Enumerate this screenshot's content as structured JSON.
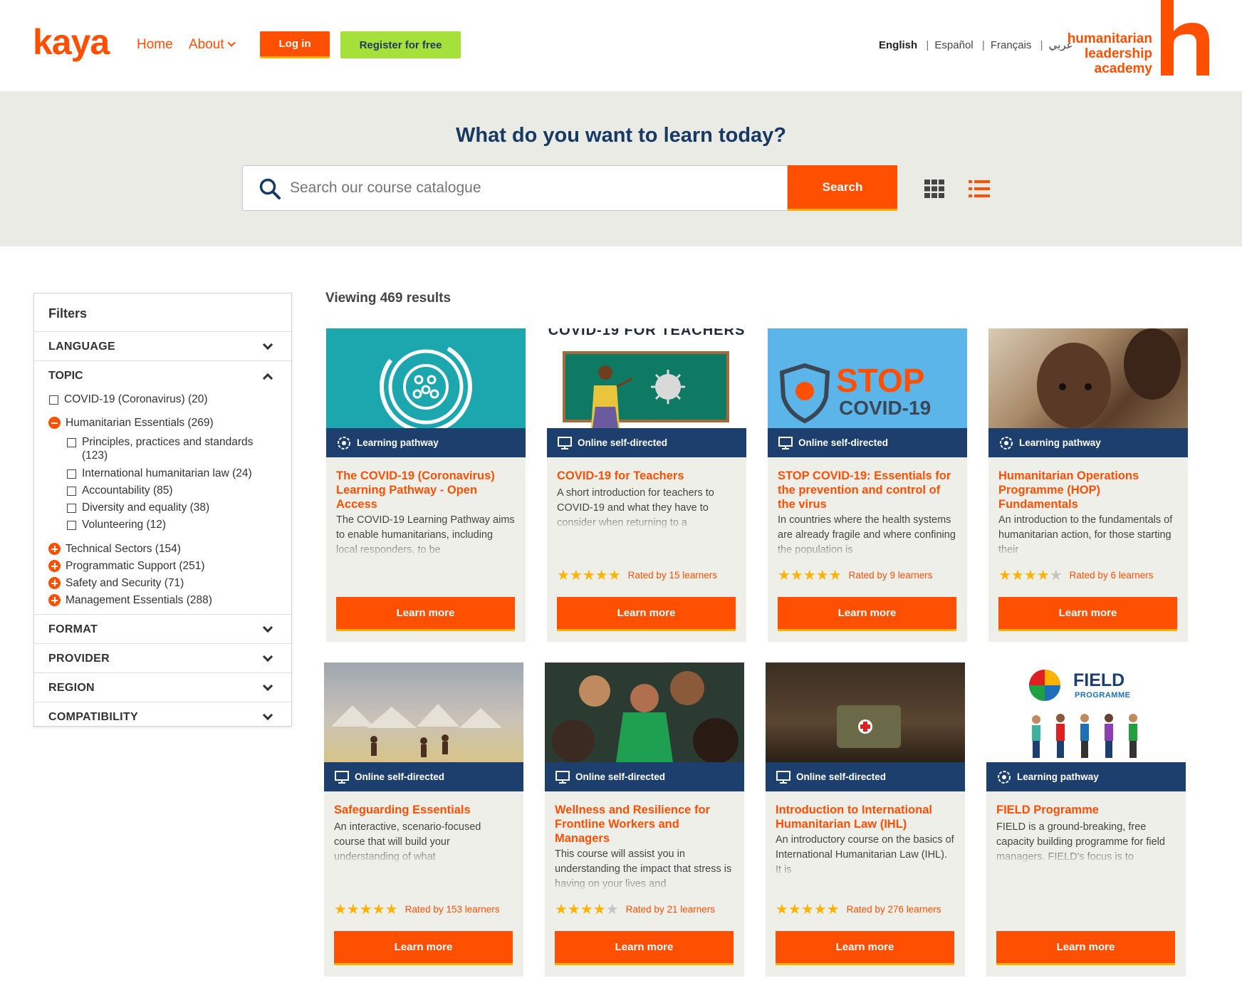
{
  "header": {
    "logo": "kaya",
    "nav": {
      "home": "Home",
      "about": "About"
    },
    "login_label": "Log in",
    "register_label": "Register for free",
    "languages": [
      {
        "label": "English",
        "active": true
      },
      {
        "label": "Español",
        "active": false
      },
      {
        "label": "Français",
        "active": false
      },
      {
        "label": "عربي",
        "active": false
      }
    ],
    "partner_logo": {
      "line1": "humanitarian",
      "line2": "leadership",
      "line3": "academy",
      "mark": "h"
    }
  },
  "hero": {
    "title": "What do you want to learn today?",
    "search_placeholder": "Search our course catalogue",
    "search_label": "Search"
  },
  "filters": {
    "title": "Filters",
    "sections": {
      "language": "LANGUAGE",
      "topic": "TOPIC",
      "format": "FORMAT",
      "provider": "PROVIDER",
      "region": "REGION",
      "compatibility": "COMPATIBILITY"
    },
    "topic_items": {
      "covid": "COVID-19 (Coronavirus) (20)",
      "essentials": "Humanitarian Essentials (269)",
      "principles": "Principles, practices and standards (123)",
      "ihl": "International humanitarian law (24)",
      "accountability": "Accountability (85)",
      "diversity": "Diversity and equality (38)",
      "volunteering": "Volunteering (12)",
      "technical": "Technical Sectors (154)",
      "programmatic": "Programmatic Support (251)",
      "safety": "Safety and Security (71)",
      "management": "Management Essentials (288)"
    }
  },
  "results": {
    "count_text": "Viewing 469 results"
  },
  "cards": [
    {
      "type": "Learning pathway",
      "title": "The COVID-19 (Coronavirus) Learning Pathway - Open Access",
      "desc": "The COVID-19 Learning Pathway aims to enable humanitarians, including local responders, to be",
      "rating": "",
      "button": "Learn more"
    },
    {
      "type": "Online self-directed",
      "title": "COVID-19 for Teachers",
      "desc": "A short introduction for teachers to COVID-19 and what they have to consider when returning to a",
      "rating": "Rated by 15 learners",
      "stars": 5,
      "button": "Learn more",
      "image_text": "COVID-19 FOR TEACHERS"
    },
    {
      "type": "Online self-directed",
      "title": "STOP COVID-19: Essentials for the prevention and control of the virus",
      "desc": "In countries where the health systems are already fragile and where confining the population is",
      "rating": "Rated by 9 learners",
      "stars": 5,
      "button": "Learn more",
      "image_text_1": "STOP",
      "image_text_2": "COVID-19"
    },
    {
      "type": "Learning pathway",
      "title": "Humanitarian Operations Programme (HOP) Fundamentals",
      "desc": "An introduction to the fundamentals of humanitarian action, for those starting their",
      "rating": "Rated by 6 learners",
      "stars": 4.5,
      "button": "Learn more"
    },
    {
      "type": "Online self-directed",
      "title": "Safeguarding Essentials",
      "desc": "An interactive, scenario-focused course that will build your understanding of what",
      "rating": "Rated by 153 learners",
      "stars": 5,
      "button": "Learn more"
    },
    {
      "type": "Online self-directed",
      "title": "Wellness and Resilience for Frontline Workers and Managers",
      "desc": "This course will assist you in understanding the impact that stress is having on your lives and",
      "rating": "Rated by 21 learners",
      "stars": 4.5,
      "button": "Learn more"
    },
    {
      "type": "Online self-directed",
      "title": "Introduction to International Humanitarian Law (IHL)",
      "desc": "An introductory course on the basics of International Humanitarian Law (IHL). It is",
      "rating": "Rated by 276 learners",
      "stars": 5,
      "button": "Learn more"
    },
    {
      "type": "Learning pathway",
      "title": "FIELD Programme",
      "desc": "FIELD is a ground-breaking, free capacity building programme for field managers. FIELD's focus is to",
      "rating": "",
      "button": "Learn more",
      "image_text_1": "FIELD",
      "image_text_2": "PROGRAMME"
    }
  ],
  "colors": {
    "brand_orange": "#ff4f00",
    "navy": "#163a63",
    "type_band": "#1d3f6e",
    "accent_yellow": "#ffb300",
    "register_green": "#a6e03a",
    "hero_bg": "#ebebe6"
  }
}
